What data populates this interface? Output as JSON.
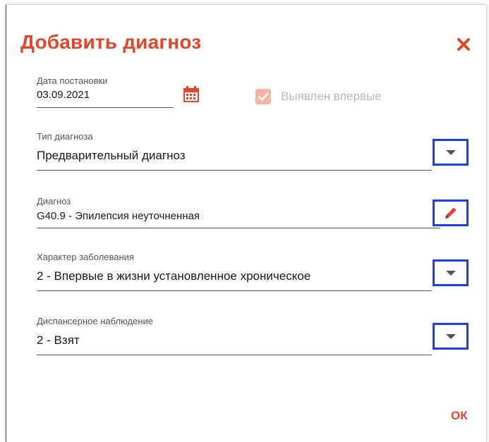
{
  "dialog": {
    "title": "Добавить диагноз",
    "ok_label": "ОК"
  },
  "date_field": {
    "label": "Дата постановки",
    "value": "03.09.2021"
  },
  "first_detected": {
    "label": "Выявлен впервые",
    "checked": true
  },
  "diagnosis_type": {
    "label": "Тип диагноза",
    "value": "Предварительный диагноз"
  },
  "diagnosis": {
    "label": "Диагноз",
    "value": "G40.9 - Эпилепсия неуточненная"
  },
  "disease_character": {
    "label": "Характер заболевания",
    "value": "2 - Впервые в жизни установленное хроническое"
  },
  "dispensary": {
    "label": "Диспансерное наблюдение",
    "value": "2 - Взят"
  },
  "colors": {
    "accent": "#e0472b",
    "highlight": "#1b3fe6",
    "checkbox_disabled": "#f6b3a5"
  }
}
